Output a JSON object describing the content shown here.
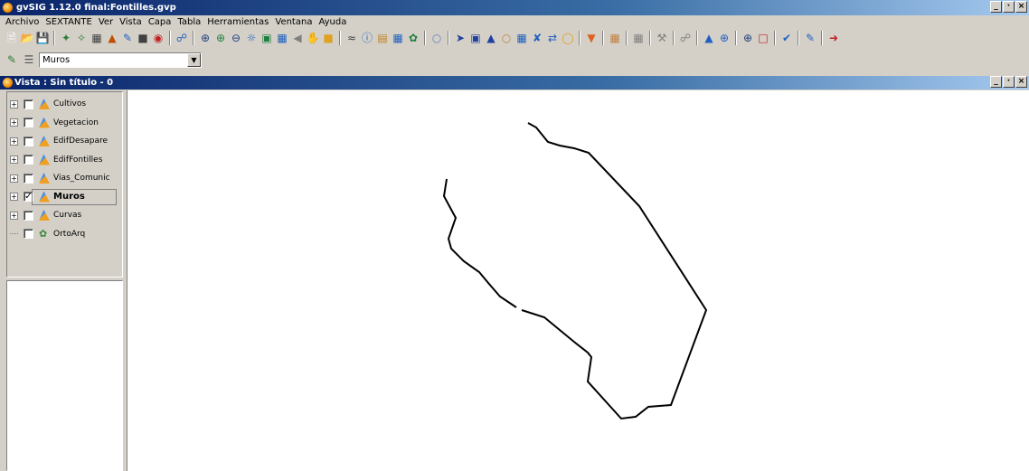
{
  "app": {
    "title": "gvSIG 1.12.0 final:Fontilles.gvp",
    "window_buttons": [
      "_",
      "·",
      "×"
    ]
  },
  "menu": [
    "Archivo",
    "SEXTANTE",
    "Ver",
    "Vista",
    "Capa",
    "Tabla",
    "Herramientas",
    "Ventana",
    "Ayuda"
  ],
  "toolbar": {
    "icons": [
      "new-icon",
      "open-icon",
      "save-icon",
      "sep",
      "add-layer-icon",
      "remove-layer-icon",
      "table-icon",
      "layer-properties-icon",
      "edit-icon",
      "locate-icon",
      "target-icon",
      "sep",
      "link-icon",
      "sep",
      "zoom-in-icon",
      "zoom-in-plus-icon",
      "zoom-out-icon",
      "full-extent-icon",
      "zoom-select-icon",
      "zoom-layer-icon",
      "back-icon",
      "pan-icon",
      "frame-icon",
      "sep",
      "measure-icon",
      "info-icon",
      "area-icon",
      "catalog-icon",
      "hyperlink-icon",
      "sep",
      "tooltip-icon",
      "sep",
      "select-icon",
      "select-rect-icon",
      "select-poly-icon",
      "select-circle-icon",
      "table-select-icon",
      "clear-selection-icon",
      "invert-icon",
      "buffer-icon",
      "sep",
      "filter-icon",
      "sep",
      "export-icon",
      "sep",
      "grid-icon",
      "sep",
      "tools-icon",
      "sep",
      "connect-icon",
      "sep",
      "raster-icon",
      "zoom-raster-icon",
      "sep",
      "zoom-extent-icon",
      "window-icon",
      "sep",
      "check-icon",
      "sep",
      "edit-layer-icon",
      "sep",
      "exit-icon"
    ],
    "layer_combo": {
      "value": "Muros"
    }
  },
  "view": {
    "title": "Vista : Sin título - 0",
    "window_buttons": [
      "_",
      "·",
      "×"
    ]
  },
  "toc": {
    "layers": [
      {
        "name": "Cultivos",
        "checked": false,
        "expandable": true,
        "type": "vector"
      },
      {
        "name": "Vegetacion",
        "checked": false,
        "expandable": true,
        "type": "vector"
      },
      {
        "name": "EdifDesapare",
        "checked": false,
        "expandable": true,
        "type": "vector"
      },
      {
        "name": "EdifFontilles",
        "checked": false,
        "expandable": true,
        "type": "vector"
      },
      {
        "name": "Vias_Comunic",
        "checked": false,
        "expandable": true,
        "type": "vector"
      },
      {
        "name": "Muros",
        "checked": true,
        "expandable": true,
        "type": "vector",
        "selected": true
      },
      {
        "name": "Curvas",
        "checked": false,
        "expandable": true,
        "type": "vector"
      },
      {
        "name": "OrtoArq",
        "checked": false,
        "expandable": false,
        "type": "raster"
      }
    ]
  },
  "colors": {
    "title_bar_start": "#0a246a",
    "title_bar_end": "#a6caf0",
    "window_bg": "#d4d0c8",
    "map_bg": "#ffffff",
    "wall_line": "#000000"
  }
}
